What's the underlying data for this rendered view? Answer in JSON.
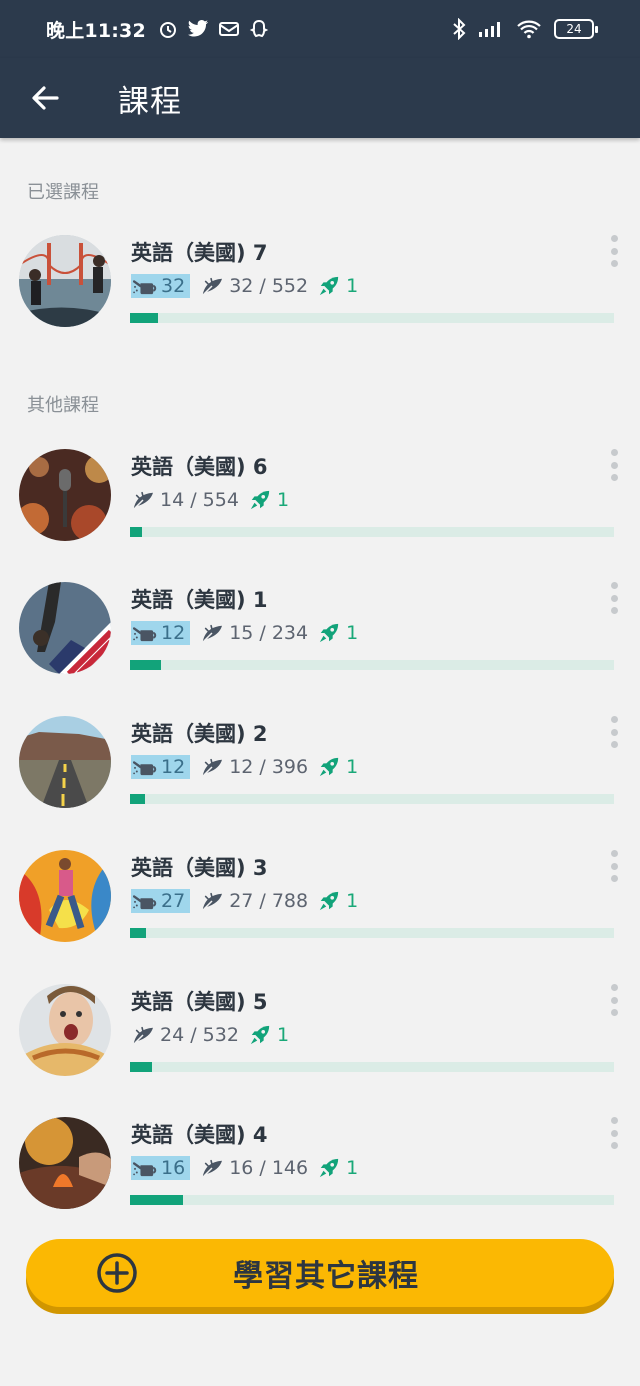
{
  "status_bar": {
    "time": "晚上11:32",
    "battery": "24",
    "icons": [
      "alarm-icon",
      "twitter-icon",
      "mail-icon",
      "snapchat-icon",
      "bluetooth-icon",
      "signal-icon",
      "wifi-icon",
      "battery-icon"
    ]
  },
  "app_bar": {
    "back_icon": "arrow-left-icon",
    "title": "課程"
  },
  "selected_section": {
    "label": "已選課程",
    "course": {
      "name": "英語（美國) 7",
      "watering": "32",
      "learned": "32 / 552",
      "boost": "1",
      "progress": 0.058,
      "image": "golden-gate-photo"
    }
  },
  "other_section": {
    "label": "其他課程",
    "courses": [
      {
        "name": "英語（美國) 6",
        "watering": null,
        "learned": "14 / 554",
        "boost": "1",
        "progress": 0.025,
        "image": "microphone-photo"
      },
      {
        "name": "英語（美國) 1",
        "watering": "12",
        "learned": "15 / 234",
        "boost": "1",
        "progress": 0.064,
        "image": "flag-photo"
      },
      {
        "name": "英語（美國) 2",
        "watering": "12",
        "learned": "12 / 396",
        "boost": "1",
        "progress": 0.03,
        "image": "road-photo"
      },
      {
        "name": "英語（美國) 3",
        "watering": "27",
        "learned": "27 / 788",
        "boost": "1",
        "progress": 0.034,
        "image": "graffiti-photo"
      },
      {
        "name": "英語（美國) 5",
        "watering": null,
        "learned": "24 / 532",
        "boost": "1",
        "progress": 0.045,
        "image": "surprised-face-photo"
      },
      {
        "name": "英語（美國) 4",
        "watering": "16",
        "learned": "16 / 146",
        "boost": "1",
        "progress": 0.11,
        "image": "campfire-photo"
      }
    ]
  },
  "cta": {
    "label": "學習其它課程",
    "icon": "plus-circle-icon"
  },
  "colors": {
    "appbar": "#2c3a4c",
    "accent_green": "#12a37a",
    "water_badge": "#9fd6ec",
    "cta": "#fbb803"
  }
}
